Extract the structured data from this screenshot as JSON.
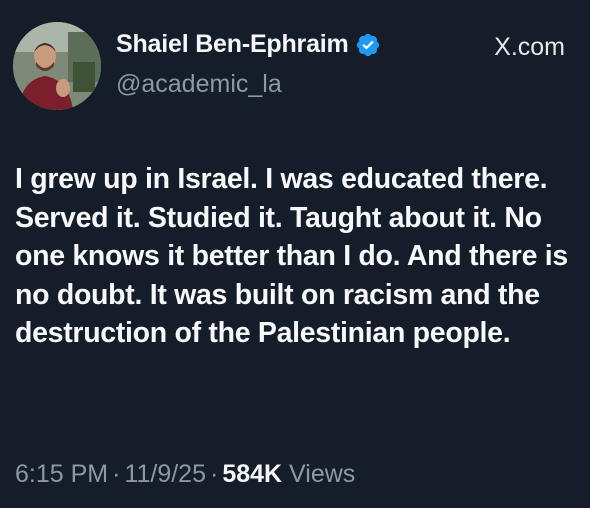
{
  "post": {
    "author": {
      "display_name": "Shaiel Ben-Ephraim",
      "handle": "@academic_la",
      "verified": true,
      "avatar": "profile-photo"
    },
    "source_label": "X.com",
    "text": "I grew up in Israel. I was educated there. Served it. Studied it. Taught about it. No one knows it better than I do. And there is no doubt. It was built on racism and the destruction of the Palestinian people.",
    "time": "6:15 PM",
    "date": "11/9/25",
    "separator": "·",
    "views_count": "584K",
    "views_label": "Views"
  },
  "colors": {
    "background": "#151d2a",
    "verified_badge": "#1d9bf0",
    "muted_text": "#8b98a5"
  }
}
